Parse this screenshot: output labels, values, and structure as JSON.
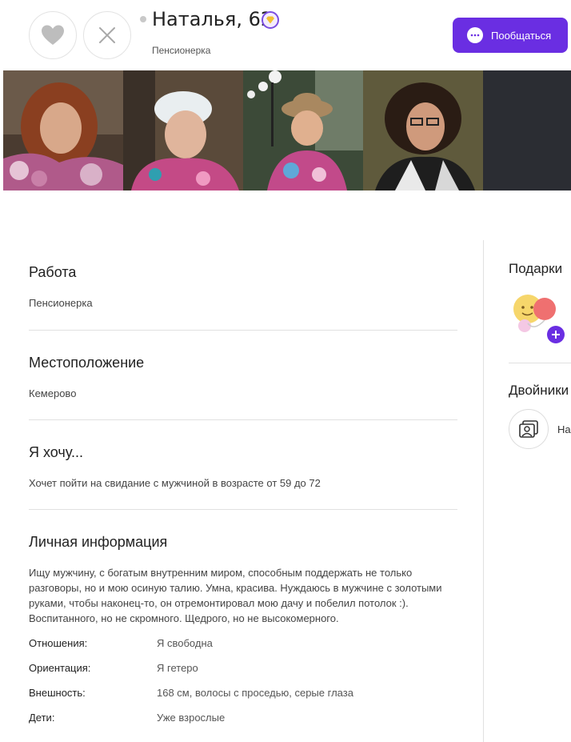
{
  "header": {
    "name_age": "Наталья, 62",
    "subtitle": "Пенсионерка",
    "chat_button_label": "Пообщаться",
    "accent_color": "#6a2ee2"
  },
  "photos": [
    {
      "icon": "photo-woman-curly-hair-flowers"
    },
    {
      "icon": "photo-woman-white-beret"
    },
    {
      "icon": "photo-woman-hat-park"
    },
    {
      "icon": "photo-woman-glasses"
    }
  ],
  "sections": {
    "work": {
      "title": "Работа",
      "value": "Пенсионерка"
    },
    "location": {
      "title": "Местоположение",
      "value": "Кемерово"
    },
    "want": {
      "title": "Я хочу...",
      "value": "Хочет пойти на свидание с мужчиной в возрасте от 59 до 72"
    },
    "personal": {
      "title": "Личная информация",
      "about": "Ищу мужчину, с богатым внутренним миром, способным поддержать не только разговоры, но и мою осиную талию. Умна, красива. Нуждаюсь в мужчине с золотыми руками, чтобы наконец-то, он отремонтировал мою дачу и побелил потолок :). Воспитанного, но не скромного. Щедрого, но не высокомерного.",
      "rows": [
        {
          "label": "Отношения:",
          "value": "Я свободна"
        },
        {
          "label": "Ориентация:",
          "value": "Я гетеро"
        },
        {
          "label": "Внешность:",
          "value": "168 см, волосы с проседью, серые глаза"
        },
        {
          "label": "Дети:",
          "value": "Уже взрослые"
        }
      ]
    }
  },
  "sidebar": {
    "gifts_title": "Подарки",
    "twins_title": "Двойники",
    "twins_label": "На"
  }
}
